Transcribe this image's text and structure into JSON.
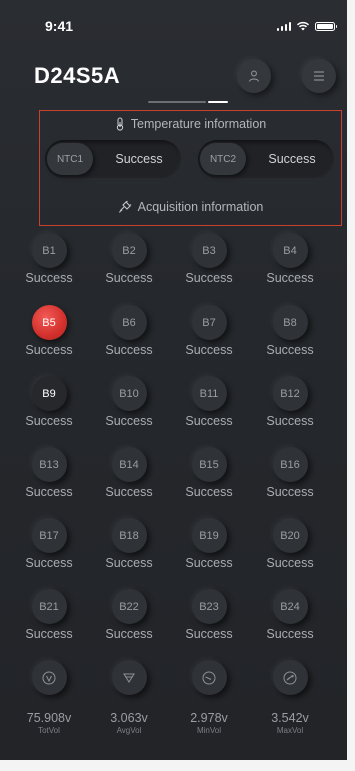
{
  "status_bar": {
    "time": "9:41"
  },
  "header": {
    "device_name": "D24S5A",
    "user_icon": "user-icon",
    "menu_icon": "menu-icon"
  },
  "info": {
    "temperature_heading": "Temperature information",
    "acquisition_heading": "Acquisition information",
    "ntc": [
      {
        "label": "NTC1",
        "status": "Success"
      },
      {
        "label": "NTC2",
        "status": "Success"
      }
    ]
  },
  "cells": [
    {
      "label": "B1",
      "status": "Success",
      "state": "normal"
    },
    {
      "label": "B2",
      "status": "Success",
      "state": "normal"
    },
    {
      "label": "B3",
      "status": "Success",
      "state": "normal"
    },
    {
      "label": "B4",
      "status": "Success",
      "state": "normal"
    },
    {
      "label": "B5",
      "status": "Success",
      "state": "alert"
    },
    {
      "label": "B6",
      "status": "Success",
      "state": "normal"
    },
    {
      "label": "B7",
      "status": "Success",
      "state": "normal"
    },
    {
      "label": "B8",
      "status": "Success",
      "state": "normal"
    },
    {
      "label": "B9",
      "status": "Success",
      "state": "selected"
    },
    {
      "label": "B10",
      "status": "Success",
      "state": "normal"
    },
    {
      "label": "B11",
      "status": "Success",
      "state": "normal"
    },
    {
      "label": "B12",
      "status": "Success",
      "state": "normal"
    },
    {
      "label": "B13",
      "status": "Success",
      "state": "normal"
    },
    {
      "label": "B14",
      "status": "Success",
      "state": "normal"
    },
    {
      "label": "B15",
      "status": "Success",
      "state": "normal"
    },
    {
      "label": "B16",
      "status": "Success",
      "state": "normal"
    },
    {
      "label": "B17",
      "status": "Success",
      "state": "normal"
    },
    {
      "label": "B18",
      "status": "Success",
      "state": "normal"
    },
    {
      "label": "B19",
      "status": "Success",
      "state": "normal"
    },
    {
      "label": "B20",
      "status": "Success",
      "state": "normal"
    },
    {
      "label": "B21",
      "status": "Success",
      "state": "normal"
    },
    {
      "label": "B22",
      "status": "Success",
      "state": "normal"
    },
    {
      "label": "B23",
      "status": "Success",
      "state": "normal"
    },
    {
      "label": "B24",
      "status": "Success",
      "state": "normal"
    }
  ],
  "stats": [
    {
      "value": "75.908v",
      "label": "TotVol",
      "icon": "total-voltage-icon"
    },
    {
      "value": "3.063v",
      "label": "AvgVol",
      "icon": "average-voltage-icon"
    },
    {
      "value": "2.978v",
      "label": "MinVol",
      "icon": "min-voltage-icon"
    },
    {
      "value": "3.542v",
      "label": "MaxVol",
      "icon": "max-voltage-icon"
    }
  ],
  "colors": {
    "alert": "#d2302c",
    "highlight_border": "#c9402e",
    "background": "#26292d"
  }
}
